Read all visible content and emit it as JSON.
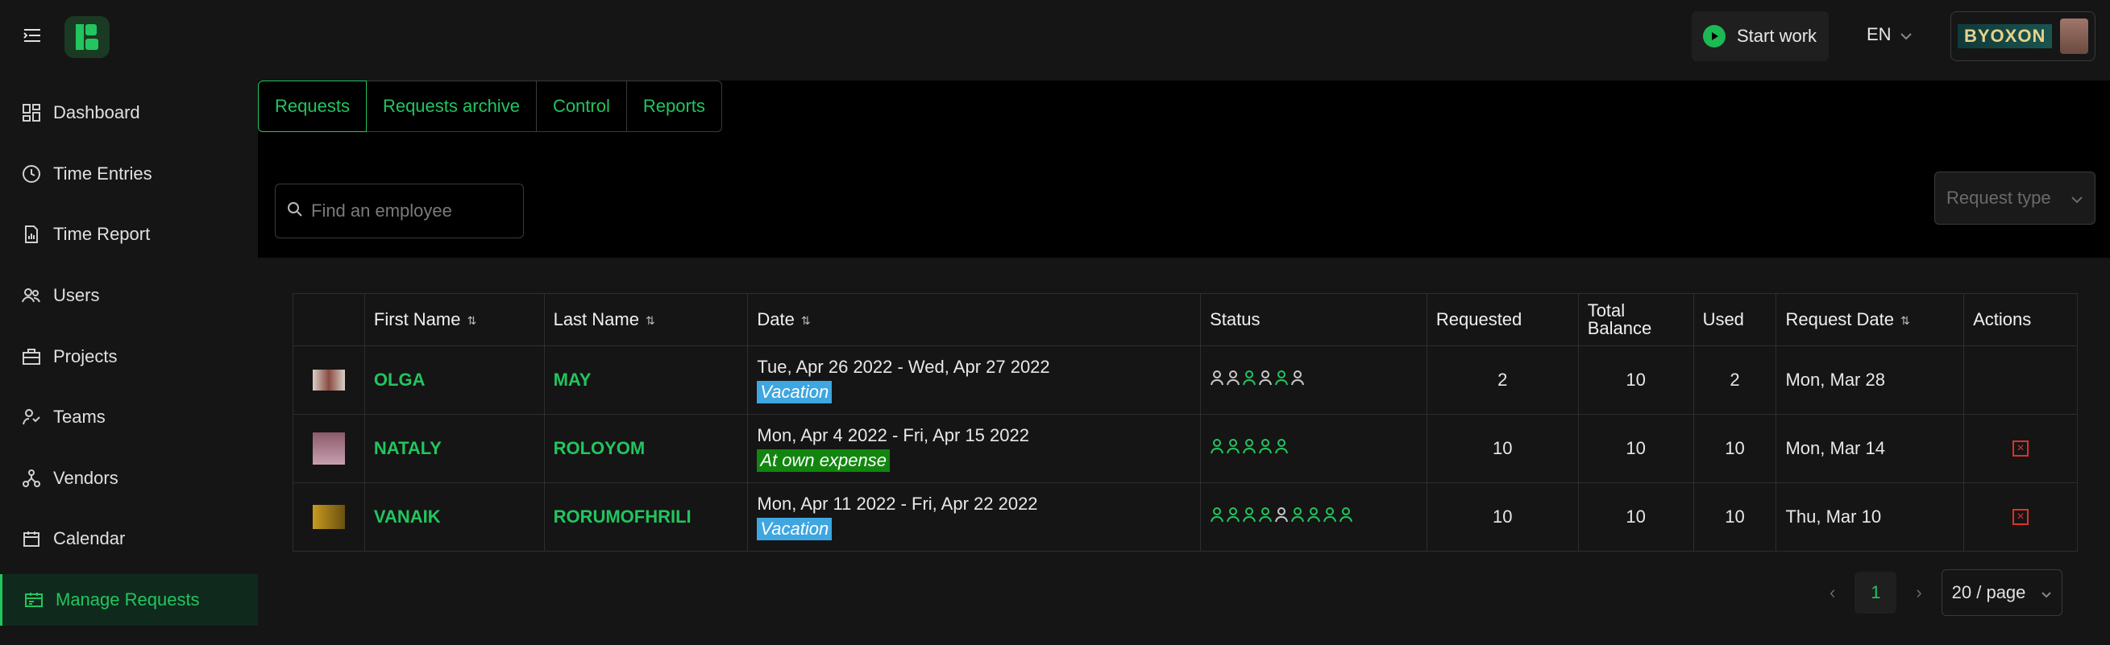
{
  "header": {
    "start_work_label": "Start work",
    "language": "EN",
    "user_logo_text": "BYOXON"
  },
  "sidebar": {
    "items": [
      {
        "label": "Dashboard",
        "icon": "dashboard-icon"
      },
      {
        "label": "Time Entries",
        "icon": "clock-icon"
      },
      {
        "label": "Time Report",
        "icon": "report-icon"
      },
      {
        "label": "Users",
        "icon": "users-icon"
      },
      {
        "label": "Projects",
        "icon": "briefcase-icon"
      },
      {
        "label": "Teams",
        "icon": "team-icon"
      },
      {
        "label": "Vendors",
        "icon": "vendors-icon"
      },
      {
        "label": "Calendar",
        "icon": "calendar-icon"
      },
      {
        "label": "Manage Requests",
        "icon": "manage-requests-icon",
        "active": true
      }
    ]
  },
  "tabs": [
    {
      "label": "Requests",
      "active": true
    },
    {
      "label": "Requests archive"
    },
    {
      "label": "Control"
    },
    {
      "label": "Reports"
    }
  ],
  "search": {
    "placeholder": "Find an employee"
  },
  "request_type": {
    "placeholder": "Request type"
  },
  "table": {
    "headers": {
      "first_name": "First Name",
      "last_name": "Last Name",
      "date": "Date",
      "status": "Status",
      "requested": "Requested",
      "total_balance": "Total Balance",
      "used": "Used",
      "request_date": "Request Date",
      "actions": "Actions"
    },
    "rows": [
      {
        "first_name": "OLGA",
        "last_name": "MAY",
        "date": "Tue, Apr 26 2022 - Wed, Apr 27 2022",
        "type": "Vacation",
        "type_color": "#3ea6e0",
        "status": [
          "pending",
          "pending",
          "approved",
          "pending",
          "approved",
          "pending"
        ],
        "requested": "2",
        "total_balance": "10",
        "used": "2",
        "request_date": "Mon, Mar 28",
        "can_cancel": false
      },
      {
        "first_name": "NATALY",
        "last_name": "ROLOYOM",
        "date": "Mon, Apr 4 2022 - Fri, Apr 15 2022",
        "type": "At own expense",
        "type_color": "#12850f",
        "status": [
          "approved",
          "approved",
          "approved",
          "approved",
          "approved"
        ],
        "requested": "10",
        "total_balance": "10",
        "used": "10",
        "request_date": "Mon, Mar 14",
        "can_cancel": true
      },
      {
        "first_name": "VANAIK",
        "last_name": "RORUMOFHRILI",
        "date": "Mon, Apr 11 2022 - Fri, Apr 22 2022",
        "type": "Vacation",
        "type_color": "#3ea6e0",
        "status": [
          "approved",
          "approved",
          "approved",
          "approved",
          "pending",
          "approved",
          "approved",
          "approved",
          "approved"
        ],
        "requested": "10",
        "total_balance": "10",
        "used": "10",
        "request_date": "Thu, Mar 10",
        "can_cancel": true
      }
    ]
  },
  "pagination": {
    "current": "1",
    "page_size": "20 / page"
  },
  "colors": {
    "accent": "#22c55e",
    "approved": "#22c55e",
    "pending": "#c8c8c8",
    "danger": "#e0302a"
  }
}
